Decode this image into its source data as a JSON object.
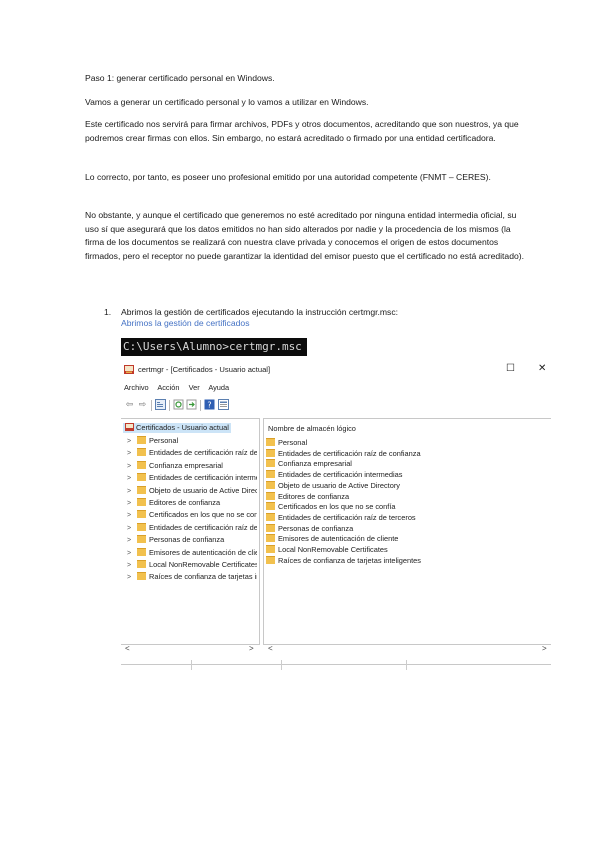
{
  "document": {
    "paragraphs": [
      "Paso 1: generar certificado personal en Windows.",
      "Vamos a generar un certificado personal y lo vamos a utilizar en Windows.",
      "Este certificado nos servirá para firmar archivos, PDFs y otros documentos, acreditando que son nuestros, ya que podremos crear firmas con ellos. Sin embargo, no estará acreditado o firmado por una entidad certificadora.",
      "Lo correcto, por tanto, es poseer uno profesional emitido por una autoridad competente (FNMT – CERES).",
      "No obstante, y aunque el certificado que generemos no esté acreditado por ninguna entidad intermedia oficial, su uso sí que asegurará que los datos emitidos no han sido alterados por nadie y la procedencia de los mismos (la firma de los documentos se realizará con nuestra clave privada y conocemos el origen de estos documentos firmados, pero el receptor no puede garantizar la identidad del emisor puesto que el certificado no está acreditado)."
    ],
    "list_item": {
      "number": "1.",
      "text": "Abrimos la gestión de certificados ejecutando la instrucción certmgr.msc:"
    },
    "figure_caption": "Abrimos la gestión de certificados"
  },
  "console": {
    "command_text": "C:\\Users\\Alumno>certmgr.msc",
    "background": "#0c0c0c"
  },
  "certmgr_window": {
    "title": "certmgr - [Certificados - Usuario actual]",
    "maximize_glyph": "☐",
    "close_glyph": "✕",
    "menu": [
      "Archivo",
      "Acción",
      "Ver",
      "Ayuda"
    ],
    "toolbar_icons": [
      "back-arrow",
      "forward-arrow",
      "console-tree",
      "refresh",
      "export",
      "help",
      "properties"
    ],
    "tree_root": "Certificados - Usuario actual",
    "tree_items": [
      "Personal",
      "Entidades de certificación raíz de confianza",
      "Confianza empresarial",
      "Entidades de certificación intermedias",
      "Objeto de usuario de Active Directory",
      "Editores de confianza",
      "Certificados en los que no se confía",
      "Entidades de certificación raíz de terceros",
      "Personas de confianza",
      "Emisores de autenticación de cliente",
      "Local NonRemovable Certificates",
      "Raíces de confianza de tarjetas inteligentes"
    ],
    "right_header": "Nombre de almacén lógico",
    "right_items": [
      "Personal",
      "Entidades de certificación raíz de confianza",
      "Confianza empresarial",
      "Entidades de certificación intermedias",
      "Objeto de usuario de Active Directory",
      "Editores de confianza",
      "Certificados en los que no se confía",
      "Entidades de certificación raíz de terceros",
      "Personas de confianza",
      "Emisores de autenticación de cliente",
      "Local NonRemovable Certificates",
      "Raíces de confianza de tarjetas inteligentes"
    ],
    "scroll_left_glyph": "<",
    "scroll_right_glyph": ">",
    "selection_color": "#cce4f7",
    "folder_color": "#f2c14e"
  }
}
